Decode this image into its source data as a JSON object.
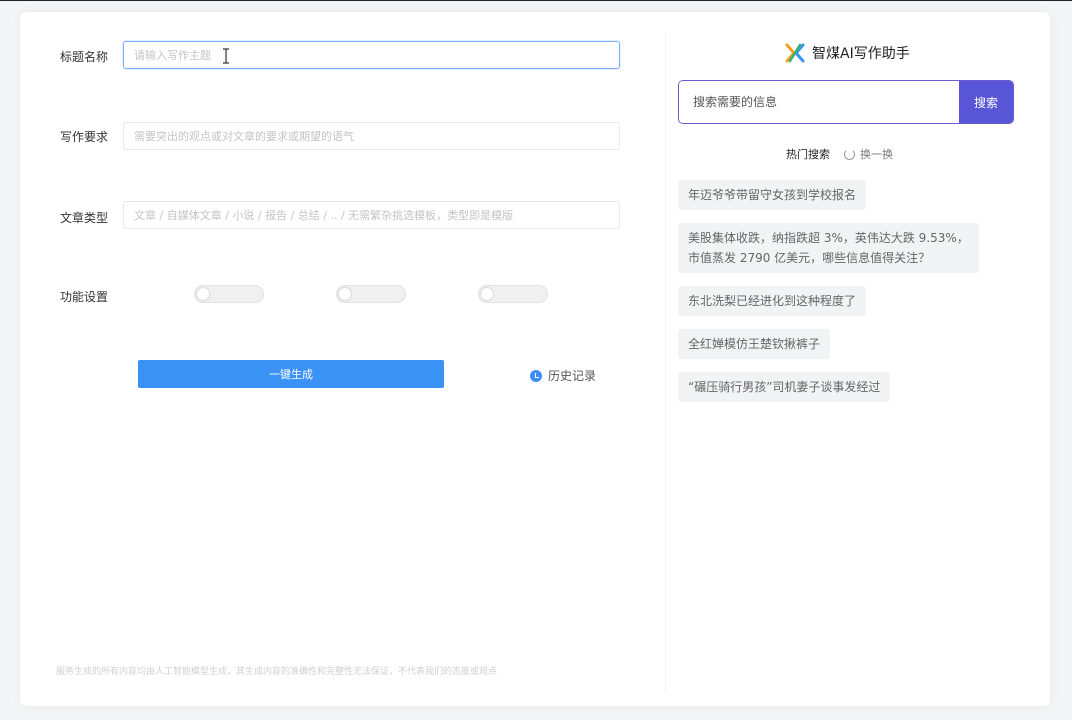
{
  "form": {
    "title_label": "标题名称",
    "title_placeholder": "请输入写作主题",
    "requirements_label": "写作要求",
    "requirements_placeholder": "需要突出的观点或对文章的要求或期望的语气",
    "type_label": "文章类型",
    "type_placeholder": "文章 / 自媒体文章 / 小说 / 报告 / 总结 / .. / 无需繁杂挑选模板，类型即是模版",
    "settings_label": "功能设置",
    "toggles": [
      {
        "name": "setting-toggle-1",
        "on": false
      },
      {
        "name": "setting-toggle-2",
        "on": false
      },
      {
        "name": "setting-toggle-3",
        "on": false
      }
    ],
    "generate_button": "一键生成",
    "history_link": "历史记录",
    "footer_note": "服务生成的所有内容均由人工智能模型生成，其生成内容的准确性和完整性无法保证，不代表我们的态度或观点"
  },
  "assistant": {
    "brand_name": "智煤AI写作助手",
    "search_placeholder": "搜索需要的信息",
    "search_button": "搜索",
    "hot_title": "热门搜索",
    "refresh_label": "换一换",
    "hot_items": [
      "年迈爷爷带留守女孩到学校报名",
      "美股集体收跌，纳指跌超 3%，英伟达大跌 9.53%，",
      "市值蒸发 2790 亿美元，哪些信息值得关注？",
      "东北洗梨已经进化到这种程度了",
      "全红婵模仿王楚钦揪裤子",
      "“碾压骑行男孩”司机妻子谈事发经过"
    ]
  },
  "colors": {
    "primary_blue": "#3a92f5",
    "search_purple": "#5856d6"
  }
}
